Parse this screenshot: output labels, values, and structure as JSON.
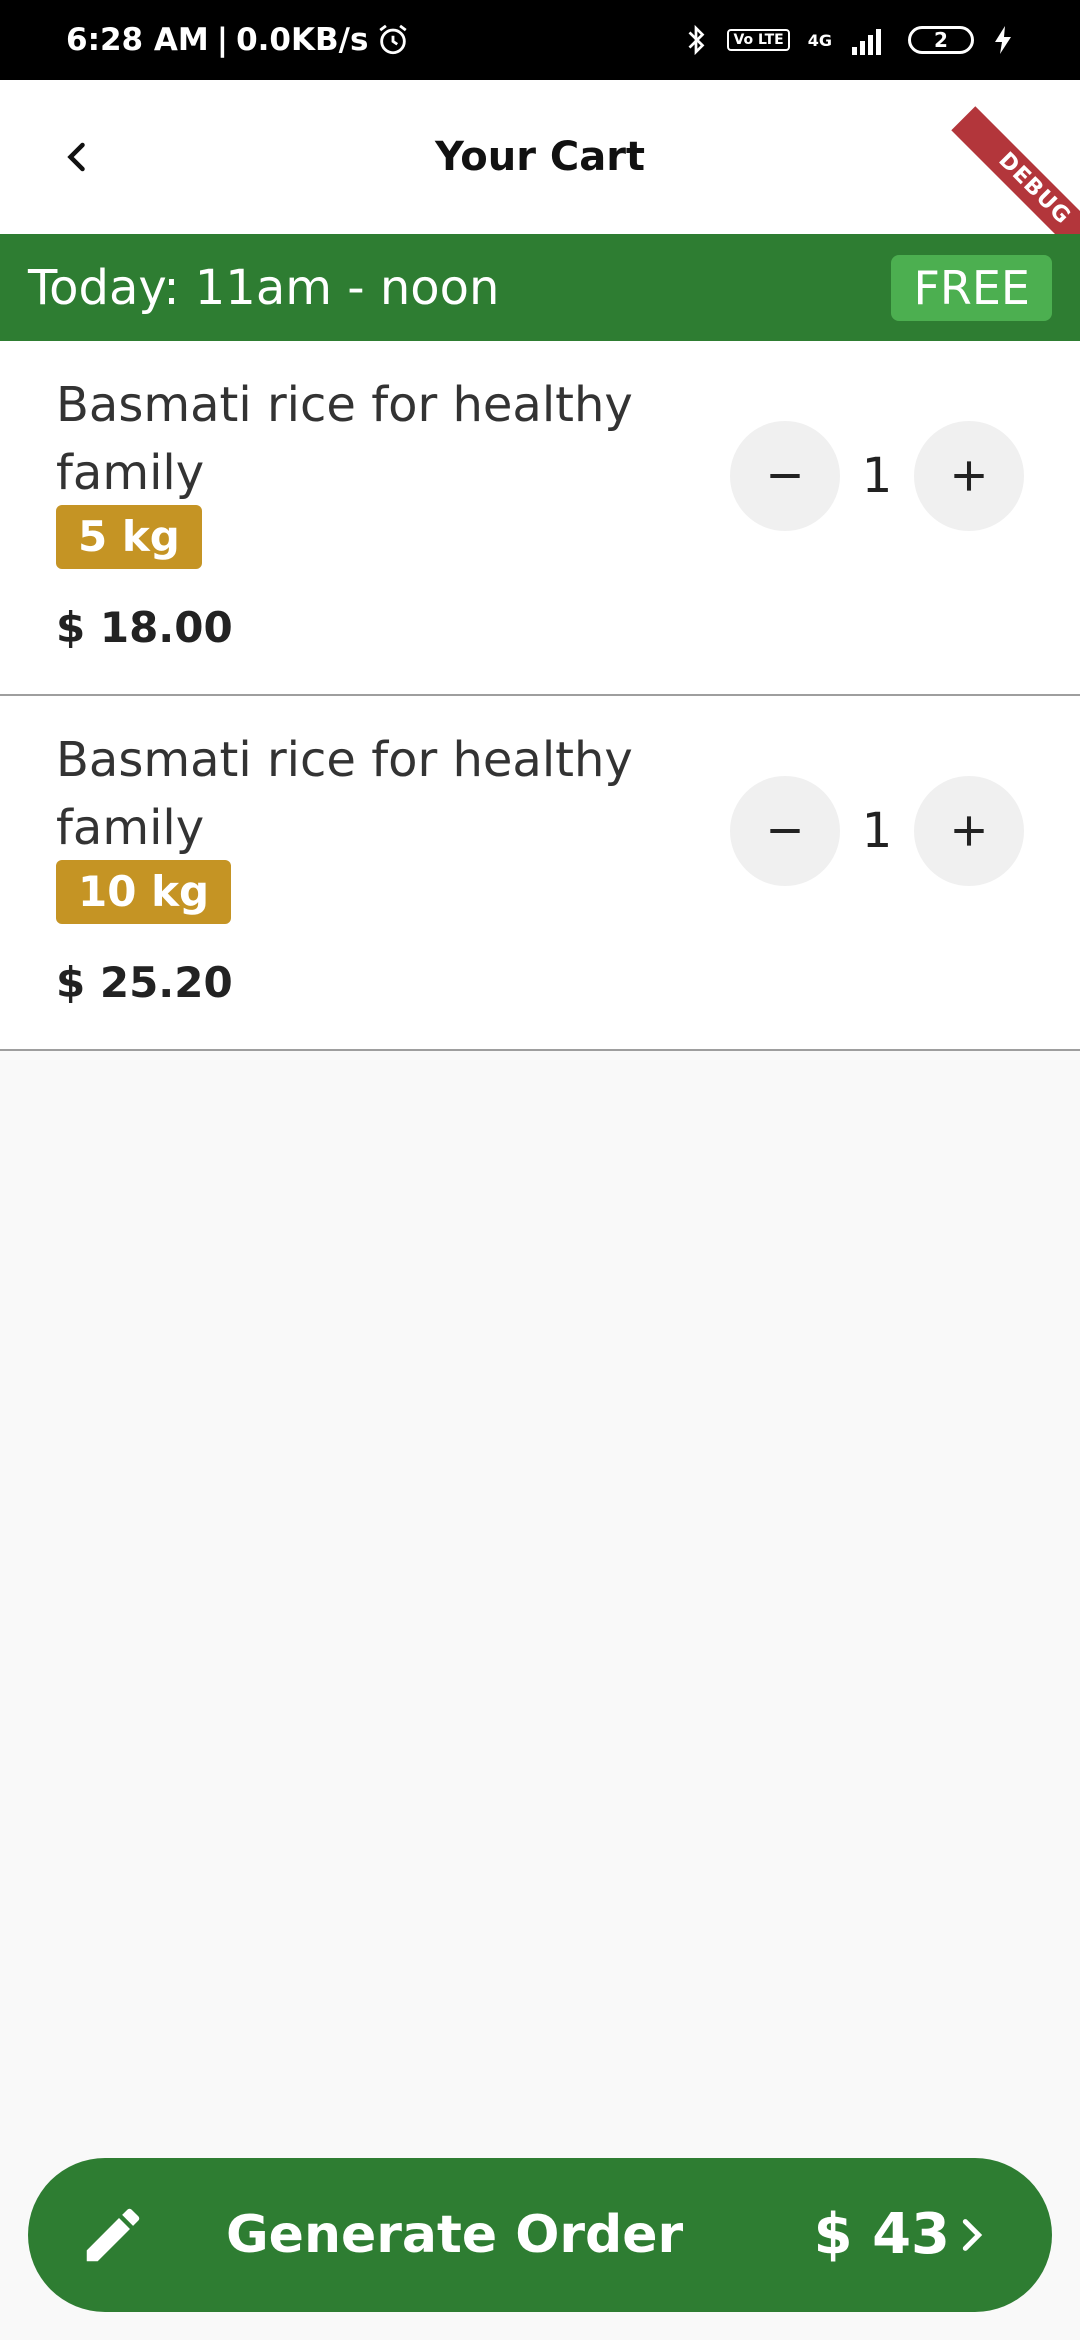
{
  "status_bar": {
    "time": "6:28 AM",
    "speed": "0.0KB/s",
    "network": "4G",
    "volte": "Vo LTE",
    "battery": "2"
  },
  "header": {
    "title": "Your Cart",
    "debug_banner": "DEBUG"
  },
  "delivery": {
    "slot": "Today: 11am - noon",
    "fee": "FREE"
  },
  "cart": {
    "items": [
      {
        "name": "Basmati rice for healthy family",
        "weight": "5 kg",
        "price": "$ 18.00",
        "qty": "1"
      },
      {
        "name": "Basmati rice for healthy family",
        "weight": "10 kg",
        "price": "$ 25.20",
        "qty": "1"
      }
    ]
  },
  "footer": {
    "order_label": "Generate Order",
    "total": "$ 43"
  },
  "colors": {
    "primary_green": "#2e7d32",
    "light_green": "#4caf50",
    "badge_gold": "#c59424"
  }
}
